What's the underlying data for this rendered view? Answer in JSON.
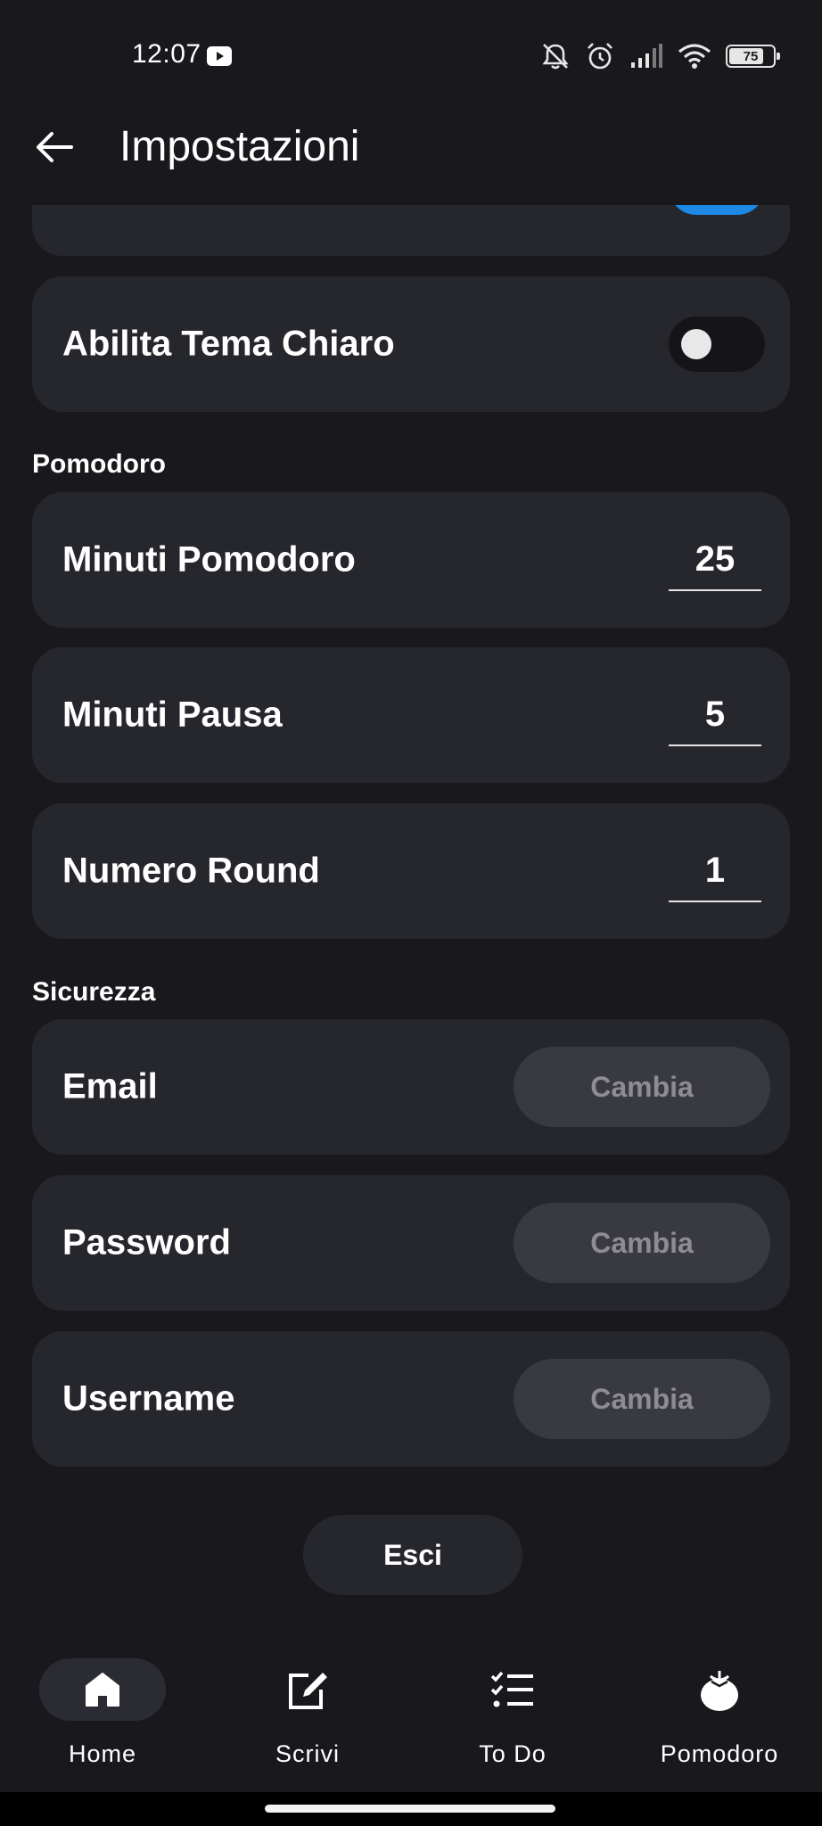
{
  "status_bar": {
    "time": "12:07",
    "battery": "75",
    "icons": [
      "youtube-icon",
      "bell-off-icon",
      "alarm-icon",
      "signal-icon",
      "wifi-icon",
      "battery-icon"
    ]
  },
  "app_bar": {
    "title": "Impostazioni",
    "back_icon": "arrow-left-icon"
  },
  "theme": {
    "light_theme_label": "Abilita Tema Chiaro",
    "light_theme_enabled": false,
    "top_toggle_enabled": true,
    "accent_color": "#1e88e5"
  },
  "pomodoro": {
    "section_title": "Pomodoro",
    "fields": [
      {
        "label": "Minuti Pomodoro",
        "value": "25"
      },
      {
        "label": "Minuti Pausa",
        "value": "5"
      },
      {
        "label": "Numero Round",
        "value": "1"
      }
    ]
  },
  "security": {
    "section_title": "Sicurezza",
    "rows": [
      {
        "label": "Email",
        "button": "Cambia"
      },
      {
        "label": "Password",
        "button": "Cambia"
      },
      {
        "label": "Username",
        "button": "Cambia"
      }
    ]
  },
  "exit_label": "Esci",
  "bottom_nav": {
    "items": [
      {
        "label": "Home",
        "icon": "home-icon",
        "active": true
      },
      {
        "label": "Scrivi",
        "icon": "edit-icon",
        "active": false
      },
      {
        "label": "To Do",
        "icon": "checklist-icon",
        "active": false
      },
      {
        "label": "Pomodoro",
        "icon": "tomato-icon",
        "active": false
      }
    ]
  },
  "colors": {
    "background": "#19191d",
    "card": "#26262d",
    "button": "#393942"
  }
}
